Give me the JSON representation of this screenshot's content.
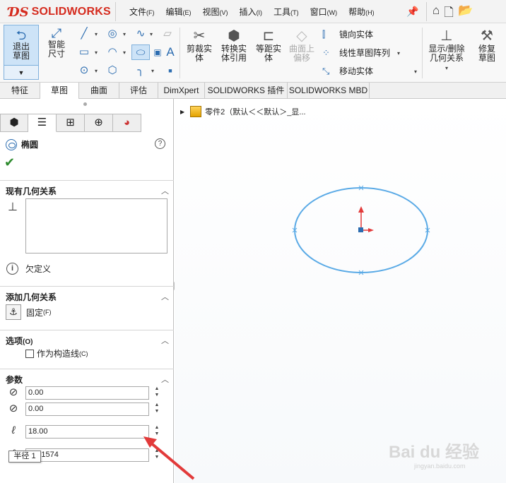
{
  "app": {
    "logo": "SOLIDWORKS"
  },
  "menu": [
    {
      "label": "文件",
      "key": "(F)"
    },
    {
      "label": "编辑",
      "key": "(E)"
    },
    {
      "label": "视图",
      "key": "(V)"
    },
    {
      "label": "插入",
      "key": "(I)"
    },
    {
      "label": "工具",
      "key": "(T)"
    },
    {
      "label": "窗口",
      "key": "(W)"
    },
    {
      "label": "帮助",
      "key": "(H)"
    }
  ],
  "ribbon": {
    "exit_sketch": "退出草图",
    "smart_dim": "智能尺寸",
    "trim": "剪裁实体",
    "convert": "转换实体引用",
    "offset": "等距实体",
    "surface_offset": "曲面上偏移",
    "mirror": "镜向实体",
    "linear_pattern": "线性草图阵列",
    "move": "移动实体",
    "display_relations": "显示/删除几何关系",
    "repair": "修复草图"
  },
  "tabs": [
    "特征",
    "草图",
    "曲面",
    "评估",
    "DimXpert",
    "SOLIDWORKS 插件",
    "SOLIDWORKS MBD"
  ],
  "panel": {
    "title": "椭圆",
    "existing_relations": {
      "header": "现有几何关系",
      "status": "欠定义"
    },
    "add_relations": {
      "header": "添加几何关系",
      "fix_label": "固定",
      "fix_key": "(F)"
    },
    "options": {
      "header": "选项",
      "header_key": "(O)",
      "construction": "作为构造线",
      "construction_key": "(C)"
    },
    "params": {
      "header": "参数",
      "center_x": "0.00",
      "center_y": "0.00",
      "radius1": "18.00",
      "radius2": "9441574",
      "tooltip": "半径 1"
    }
  },
  "tree": {
    "part": "零件2（默认＜＜默认＞_显..."
  },
  "watermark": {
    "text": "Bai du 经验",
    "sub": "jingyan.baidu.com"
  },
  "colors": {
    "accent": "#2b6cb0",
    "ellipse": "#5aaae6",
    "selection": "#cde3f7",
    "arrow_red": "#e23a3a"
  }
}
